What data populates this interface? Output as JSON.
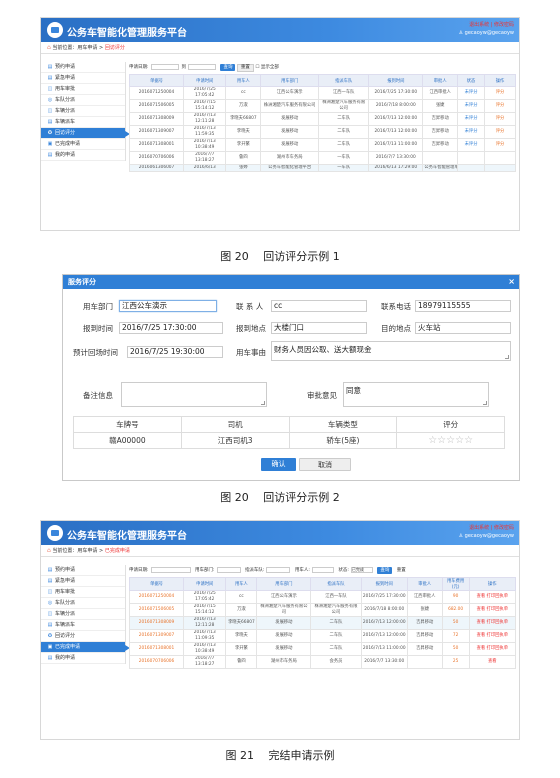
{
  "s1": {
    "app_title": "公务车智能化管理服务平台",
    "top_links": [
      "退出系统",
      "修改密码"
    ],
    "user": "gecaoyw@gecaoyw",
    "breadcrumb": {
      "prefix": "当前位置：",
      "parent": "用车申请",
      "current": "回访评分"
    },
    "sidebar": [
      "预约申请",
      "紧急申请",
      "用车审批",
      "车队分派",
      "车辆分派",
      "车辆派车",
      "回访评分",
      "已完成申请",
      "我的申请"
    ],
    "filter": {
      "label": "申请日期:",
      "to": "到",
      "query": "查询",
      "reset": "重置",
      "show_all": "显示全部"
    },
    "headers": [
      "单据号",
      "申请时间",
      "用车人",
      "用车部门",
      "指派车队",
      "报到时间",
      "审批人",
      "状态",
      "操作"
    ],
    "rows": [
      [
        "2016071250004",
        "2016/7/25 17:05:42",
        "cc",
        "江西公车演示",
        "江西一车队",
        "2016/7/25 17:30:00",
        "江西审批人",
        "未评分",
        "评分"
      ],
      [
        "2016071506005",
        "2016/7/15 15:14:12",
        "万淑",
        "株洲湘楚汽车服务有限公司",
        "株洲湘楚汽车服务有限公司",
        "2016/7/18 8:00:00",
        "张婕",
        "未评分",
        "评分"
      ],
      [
        "2016071308009",
        "2016/7/13 12:11:28",
        "李晓夫66807",
        "发展移动",
        "二车队",
        "2016/7/13 12:00:00",
        "吉昇移动",
        "未评分",
        "评分"
      ],
      [
        "2016071309007",
        "2016/7/13 11:59:35",
        "李晓夫",
        "发展移动",
        "二车队",
        "2016/7/13 12:00:00",
        "吉昇移动",
        "未评分",
        "评分"
      ],
      [
        "2016071308001",
        "2016/7/13 10:38:49",
        "李开繁",
        "发展移动",
        "二车队",
        "2016/7/13 11:00:00",
        "吉昇移动",
        "未评分",
        "评分"
      ],
      [
        "2016070706006",
        "2016/7/7 13:18:27",
        "鲁四",
        "湖州市车务局",
        "一车队",
        "2016/7/7 13:30:00",
        "",
        "",
        ""
      ],
      [
        "2016061306007",
        "2016/6/13",
        "张婷",
        "公务车智能化管理平台",
        "一车队",
        "2016/6/13 17:29:00",
        "公务车智能管理单元",
        "",
        ""
      ]
    ]
  },
  "cap1": "图 20　 回访评分示例 1",
  "dialog": {
    "title": "服务评分",
    "close": "×",
    "labels": {
      "dept": "用车部门",
      "contact": "联 系 人",
      "phone": "联系电话",
      "report_time": "报到时间",
      "report_place": "报到地点",
      "destination": "目的地点",
      "est_return": "预计回场时间",
      "reason": "用车事由",
      "remark": "备注信息",
      "opinion": "审批意见"
    },
    "values": {
      "dept": "江西公车演示",
      "contact": "cc",
      "phone": "18979115555",
      "report_time": "2016/7/25 17:30:00",
      "report_place": "大楼门口",
      "destination": "火车站",
      "est_return": "2016/7/25 19:30:00",
      "reason": "财务人员因公取、送大额现金",
      "remark": "",
      "opinion": "同意"
    },
    "table_headers": [
      "车牌号",
      "司机",
      "车辆类型",
      "评分"
    ],
    "table_row": [
      "赣A00000",
      "江西司机3",
      "轿车(5座)"
    ],
    "stars": "☆☆☆☆☆",
    "ok": "确认",
    "cancel": "取消"
  },
  "cap2": "图 20　 回访评分示例 2",
  "s3": {
    "app_title": "公务车智能化管理服务平台",
    "top_links": [
      "退出系统",
      "修改密码"
    ],
    "user": "gecaoyw@gecaoyw",
    "breadcrumb": {
      "prefix": "当前位置：",
      "parent": "用车申请",
      "current": "已完成申请"
    },
    "sidebar": [
      "预约申请",
      "紧急申请",
      "用车审批",
      "车队分派",
      "车辆分派",
      "车辆派车",
      "回访评分",
      "已完成申请",
      "我的申请"
    ],
    "filter": {
      "l1": "申请日期:",
      "l2": "用车部门:",
      "l3": "指派车队:",
      "l4": "用车人:",
      "l5": "状态:",
      "status": "已完成",
      "query": "查询",
      "reset": "重置"
    },
    "headers": [
      "单据号",
      "申请时间",
      "用车人",
      "用车部门",
      "指派车队",
      "报到时间",
      "审批人",
      "用车费用(元)",
      "操作"
    ],
    "rows": [
      [
        "2016071250004",
        "2016/7/25 17:05:42",
        "cc",
        "江西公车演示",
        "江西一车队",
        "2016/7/25 17:30:00",
        "江西审批人",
        "90",
        "查看 打印回执单"
      ],
      [
        "2016071506005",
        "2016/7/15 15:14:12",
        "万淑",
        "株洲湘楚汽车服务有限公司",
        "株洲湘楚汽车服务有限公司",
        "2016/7/18 8:00:00",
        "张婕",
        "682.00",
        "查看 打印回执单"
      ],
      [
        "2016071308009",
        "2016/7/13 12:11:28",
        "李晓夫66807",
        "发展移动",
        "二车队",
        "2016/7/13 12:00:00",
        "吉昇移动",
        "50",
        "查看 打印回执单"
      ],
      [
        "2016071309007",
        "2016/7/13 11:09:35",
        "李晓夫",
        "发展移动",
        "二车队",
        "2016/7/13 12:00:00",
        "吉昇移动",
        "72",
        "查看 打印回执单"
      ],
      [
        "2016071308001",
        "2016/7/13 10:38:49",
        "李开繁",
        "发展移动",
        "二车队",
        "2016/7/13 11:00:00",
        "吉昇移动",
        "50",
        "查看 打印回执单"
      ],
      [
        "2016070706006",
        "2016/7/7 13:18:27",
        "鲁四",
        "湖州市车务局",
        "会务员",
        "2016/7/7 13:30:00",
        "",
        "25",
        "查看"
      ]
    ]
  },
  "cap3": "图 21　 完结申请示例"
}
